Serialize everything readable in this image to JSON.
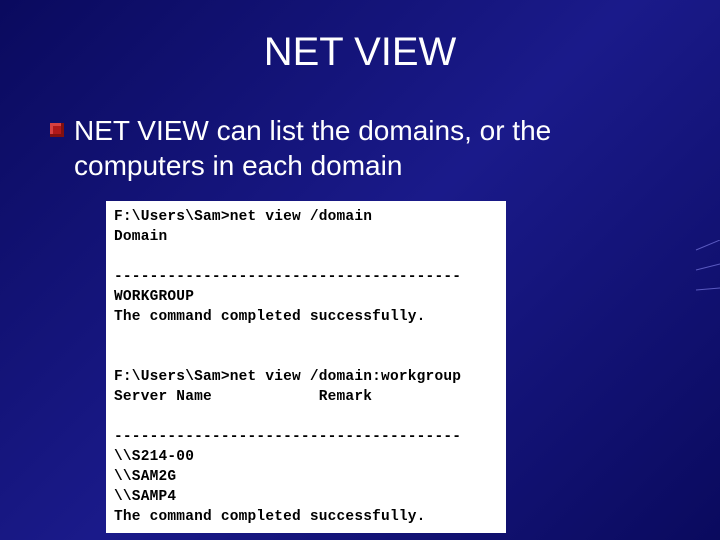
{
  "slide": {
    "title": "NET VIEW",
    "bullet": "NET VIEW can list the domains, or the computers in each domain",
    "terminal_lines": [
      "F:\\Users\\Sam>net view /domain",
      "Domain",
      "",
      "---------------------------------------",
      "WORKGROUP",
      "The command completed successfully.",
      "",
      "",
      "F:\\Users\\Sam>net view /domain:workgroup",
      "Server Name            Remark",
      "",
      "---------------------------------------",
      "\\\\S214-00",
      "\\\\SAM2G",
      "\\\\SAMP4",
      "The command completed successfully."
    ]
  }
}
